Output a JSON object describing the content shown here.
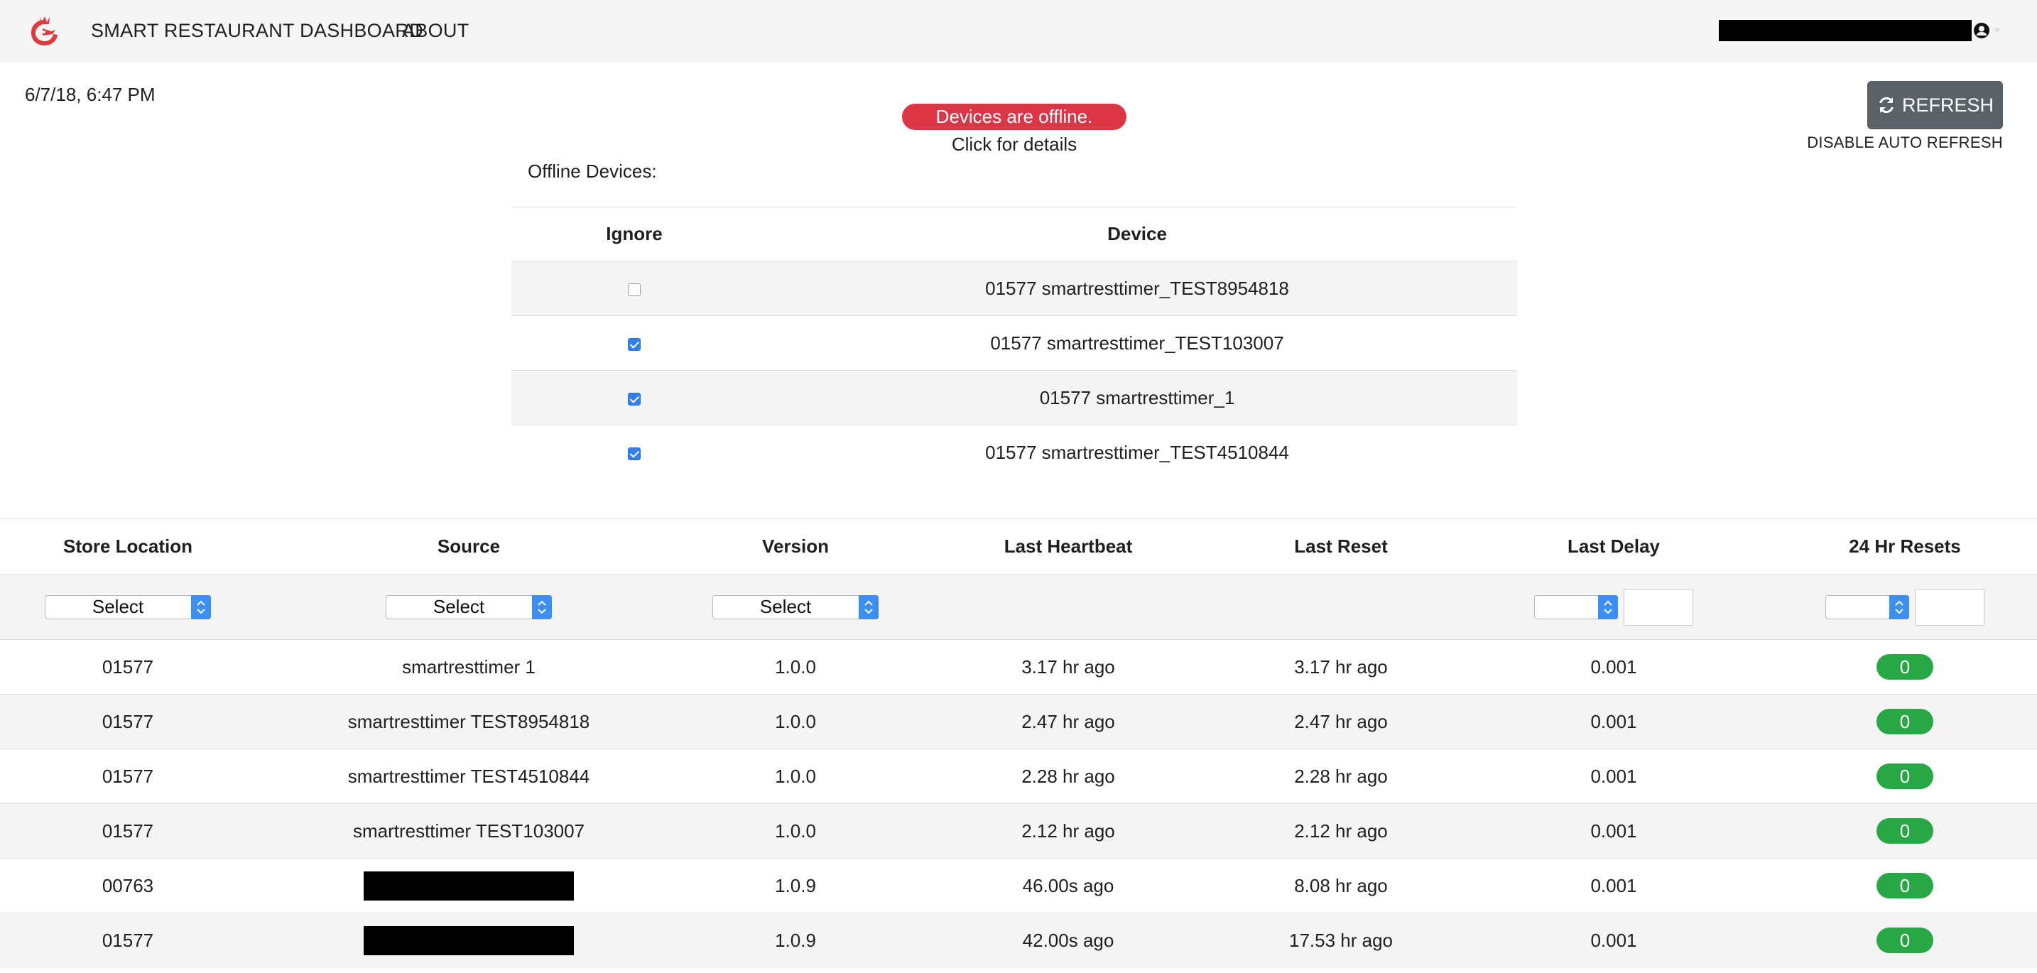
{
  "nav": {
    "title": "SMART RESTAURANT DASHBOARD",
    "about": "ABOUT",
    "icons": {
      "logo": "chicken-logo-icon",
      "user": "user-circle-icon",
      "caret": "caret-down-icon"
    },
    "logo_color": "#e03a3e"
  },
  "header": {
    "timestamp": "6/7/18, 6:47 PM",
    "status_text": "Devices are offline.",
    "details_text": "Click for details",
    "refresh_label": "REFRESH",
    "auto_refresh_label": "DISABLE AUTO REFRESH",
    "status_color": "#dc3545",
    "refresh_color": "#5a6268"
  },
  "offline": {
    "title": "Offline Devices:",
    "columns": [
      "Ignore",
      "Device"
    ],
    "rows": [
      {
        "ignored": false,
        "device": "01577 smartresttimer_TEST8954818"
      },
      {
        "ignored": true,
        "device": "01577 smartresttimer_TEST103007"
      },
      {
        "ignored": true,
        "device": "01577 smartresttimer_1"
      },
      {
        "ignored": true,
        "device": "01577 smartresttimer_TEST4510844"
      }
    ]
  },
  "table": {
    "columns": [
      "Store Location",
      "Source",
      "Version",
      "Last Heartbeat",
      "Last Reset",
      "Last Delay",
      "24 Hr Resets"
    ],
    "filters": {
      "store_location": "Select",
      "source": "Select",
      "version": "Select"
    },
    "badge_color": "#28a745",
    "rows": [
      {
        "store": "01577",
        "source": "smartresttimer 1",
        "version": "1.0.0",
        "heartbeat": "3.17 hr ago",
        "reset": "3.17 hr ago",
        "delay": "0.001",
        "resets": "0",
        "source_redacted": false
      },
      {
        "store": "01577",
        "source": "smartresttimer TEST8954818",
        "version": "1.0.0",
        "heartbeat": "2.47 hr ago",
        "reset": "2.47 hr ago",
        "delay": "0.001",
        "resets": "0",
        "source_redacted": false
      },
      {
        "store": "01577",
        "source": "smartresttimer TEST4510844",
        "version": "1.0.0",
        "heartbeat": "2.28 hr ago",
        "reset": "2.28 hr ago",
        "delay": "0.001",
        "resets": "0",
        "source_redacted": false
      },
      {
        "store": "01577",
        "source": "smartresttimer TEST103007",
        "version": "1.0.0",
        "heartbeat": "2.12 hr ago",
        "reset": "2.12 hr ago",
        "delay": "0.001",
        "resets": "0",
        "source_redacted": false
      },
      {
        "store": "00763",
        "source": "",
        "version": "1.0.9",
        "heartbeat": "46.00s ago",
        "reset": "8.08 hr ago",
        "delay": "0.001",
        "resets": "0",
        "source_redacted": true
      },
      {
        "store": "01577",
        "source": "",
        "version": "1.0.9",
        "heartbeat": "42.00s ago",
        "reset": "17.53 hr ago",
        "delay": "0.001",
        "resets": "0",
        "source_redacted": true
      }
    ]
  }
}
